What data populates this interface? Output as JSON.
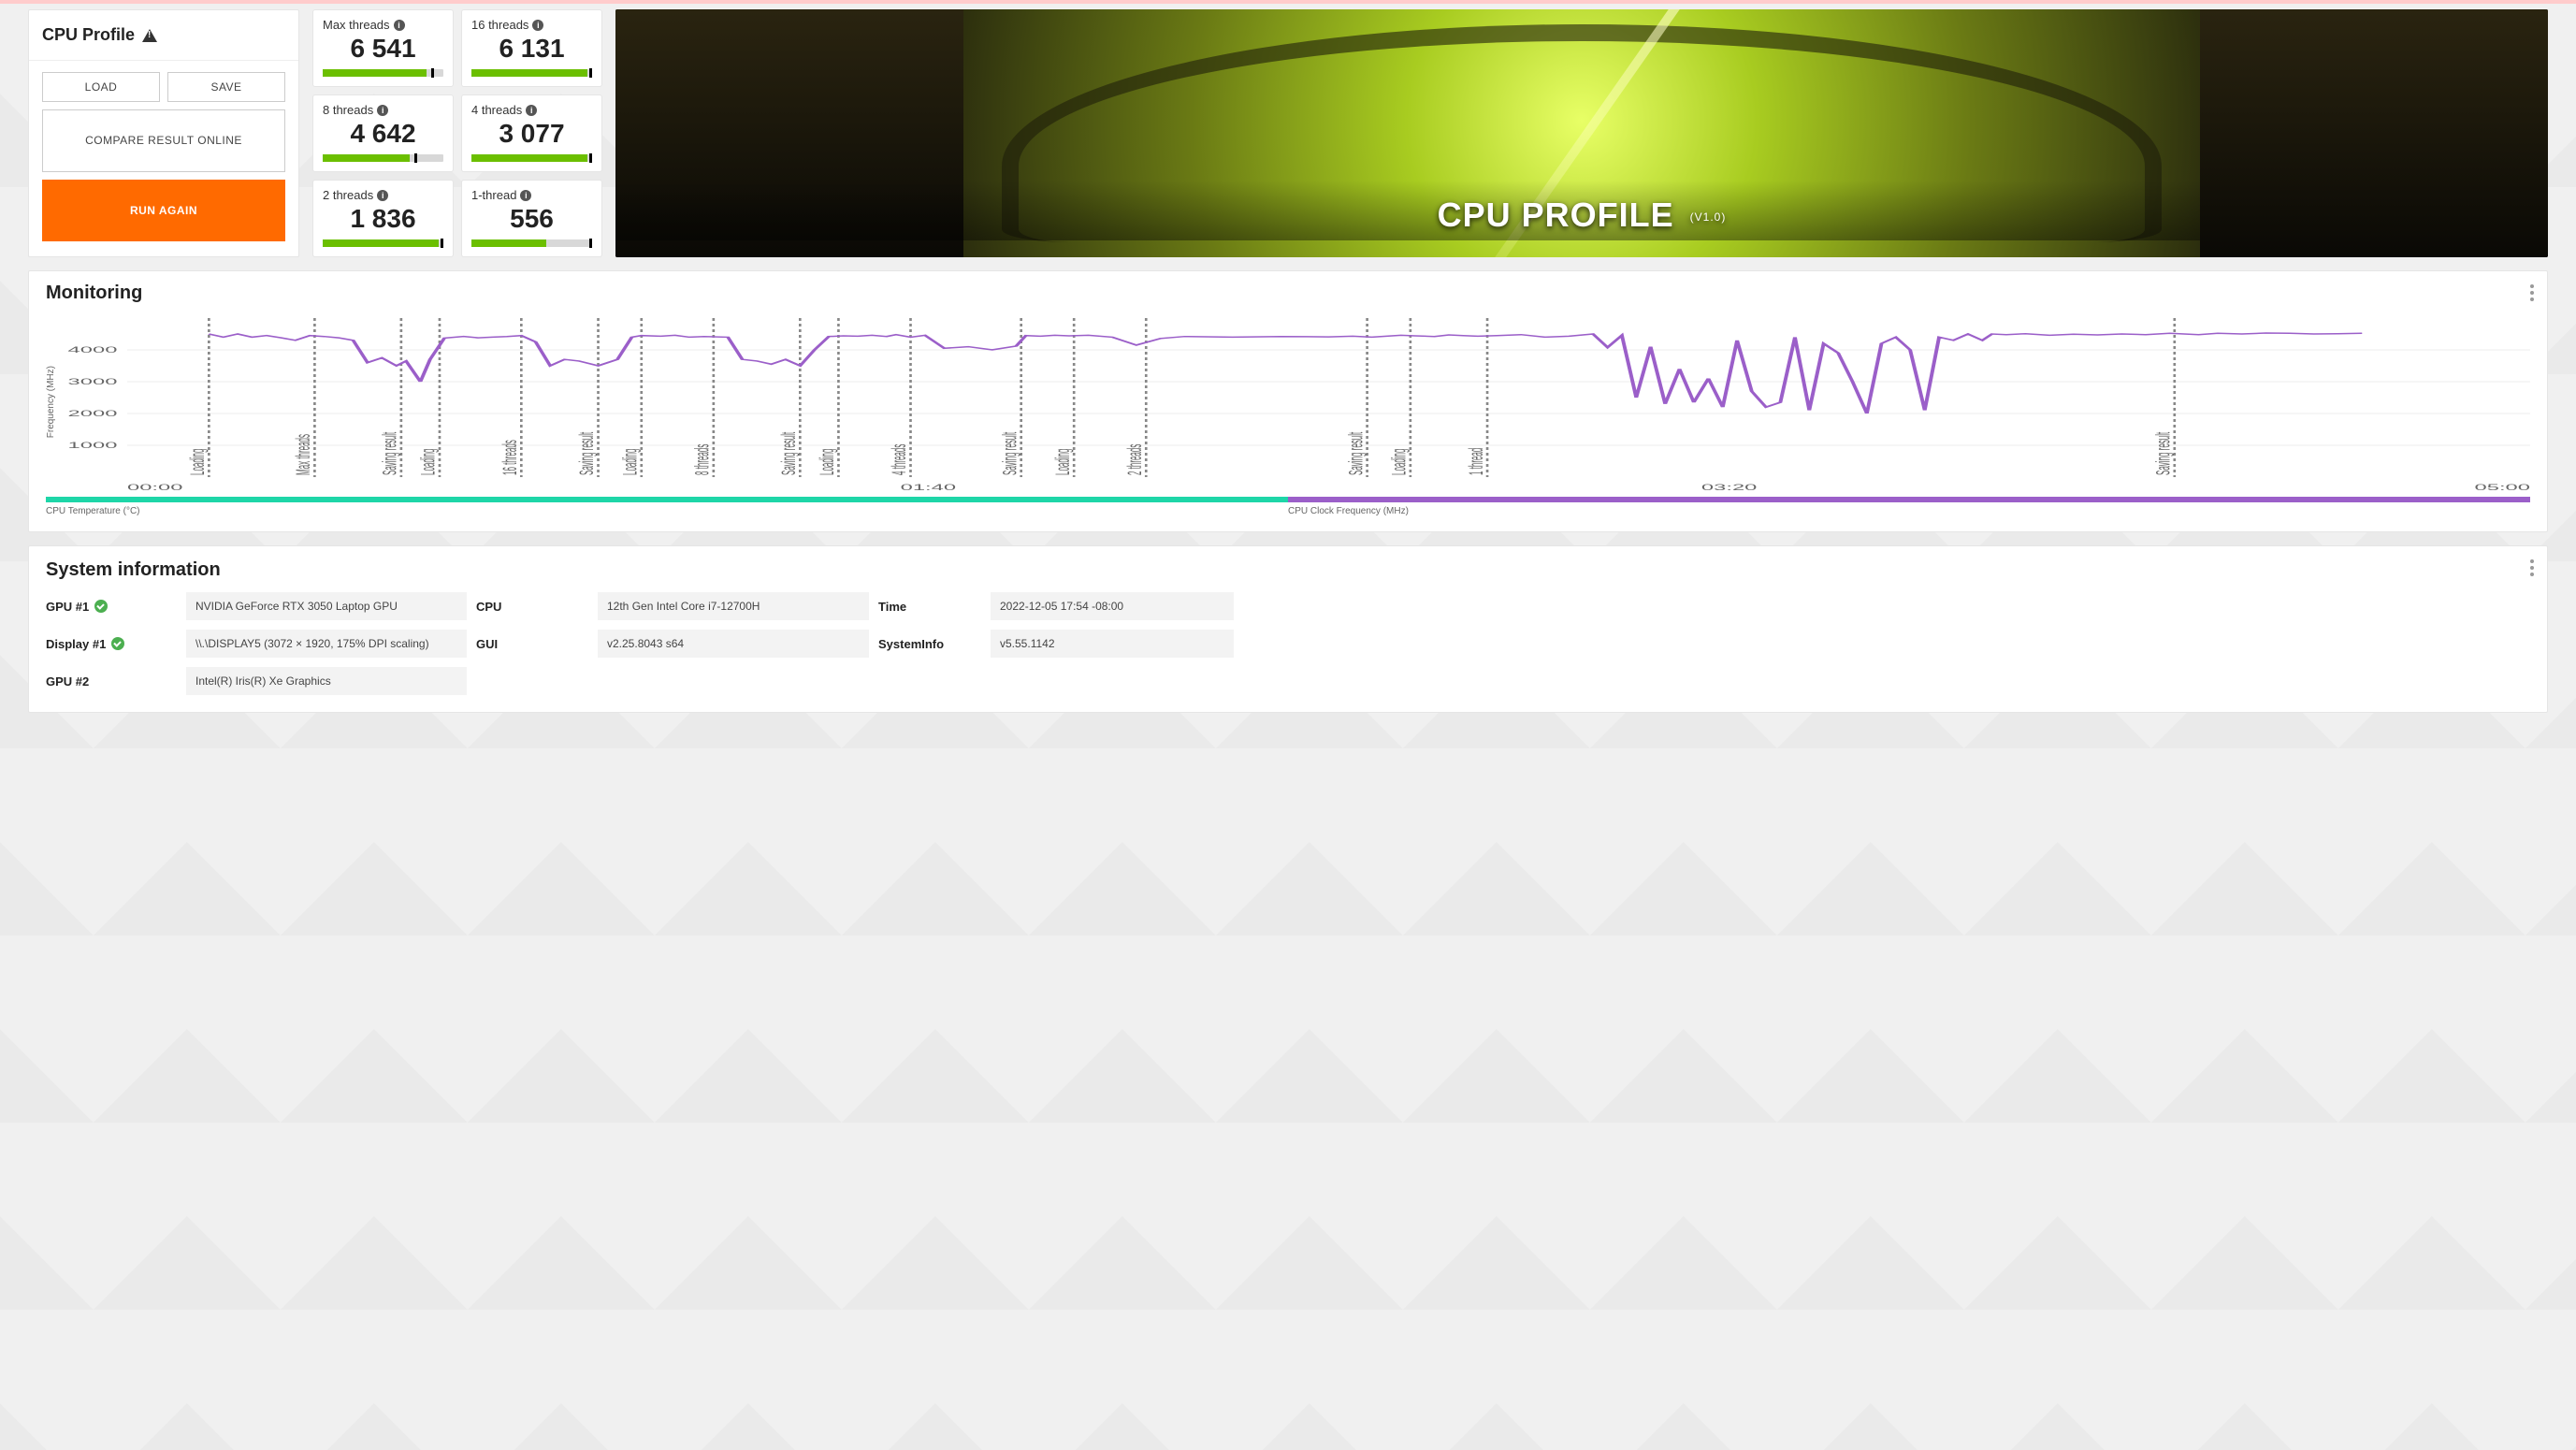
{
  "profile": {
    "title": "CPU Profile",
    "load": "LOAD",
    "save": "SAVE",
    "compare": "COMPARE RESULT ONLINE",
    "run": "RUN AGAIN"
  },
  "scores": [
    {
      "label": "Max threads",
      "value": "6 541",
      "fill": 86,
      "tick": 90
    },
    {
      "label": "16 threads",
      "value": "6 131",
      "fill": 96,
      "tick": 98
    },
    {
      "label": "8 threads",
      "value": "4 642",
      "fill": 72,
      "tick": 76
    },
    {
      "label": "4 threads",
      "value": "3 077",
      "fill": 96,
      "tick": 98
    },
    {
      "label": "2 threads",
      "value": "1 836",
      "fill": 96,
      "tick": 98
    },
    {
      "label": "1-thread",
      "value": "556",
      "fill": 62,
      "tick": 98
    }
  ],
  "hero": {
    "title": "CPU PROFILE",
    "version": "(V1.0)"
  },
  "monitoring": {
    "title": "Monitoring",
    "ylabel": "Frequency (MHz)",
    "legend_left": "CPU Temperature (°C)",
    "legend_right": "CPU Clock Frequency (MHz)"
  },
  "sysinfo": {
    "title": "System information",
    "rows": {
      "gpu1_label": "GPU #1",
      "gpu1": "NVIDIA GeForce RTX 3050 Laptop GPU",
      "cpu_label": "CPU",
      "cpu": "12th Gen Intel Core i7-12700H",
      "time_label": "Time",
      "time": "2022-12-05 17:54 -08:00",
      "disp_label": "Display #1",
      "disp": "\\\\.\\DISPLAY5 (3072 × 1920, 175% DPI scaling)",
      "gui_label": "GUI",
      "gui": "v2.25.8043 s64",
      "si_label": "SystemInfo",
      "si": "v5.55.1142",
      "gpu2_label": "GPU #2",
      "gpu2": "Intel(R) Iris(R) Xe Graphics"
    }
  },
  "chart_data": {
    "type": "line",
    "ylabel": "Frequency (MHz)",
    "ylim": [
      0,
      5000
    ],
    "yticks": [
      1000,
      2000,
      3000,
      4000
    ],
    "xlim": [
      "00:00",
      "05:00"
    ],
    "xticks": [
      "00:00",
      "01:40",
      "03:20",
      "05:00"
    ],
    "phases": [
      {
        "x": 3.4,
        "label": "Loading"
      },
      {
        "x": 7.8,
        "label": "Max threads"
      },
      {
        "x": 11.4,
        "label": "Saving result"
      },
      {
        "x": 13.0,
        "label": "Loading"
      },
      {
        "x": 16.4,
        "label": "16 threads"
      },
      {
        "x": 19.6,
        "label": "Saving result"
      },
      {
        "x": 21.4,
        "label": "Loading"
      },
      {
        "x": 24.4,
        "label": "8 threads"
      },
      {
        "x": 28.0,
        "label": "Saving result"
      },
      {
        "x": 29.6,
        "label": "Loading"
      },
      {
        "x": 32.6,
        "label": "4 threads"
      },
      {
        "x": 37.2,
        "label": "Saving result"
      },
      {
        "x": 39.4,
        "label": "Loading"
      },
      {
        "x": 42.4,
        "label": "2 threads"
      },
      {
        "x": 51.6,
        "label": "Saving result"
      },
      {
        "x": 53.4,
        "label": "Loading"
      },
      {
        "x": 56.6,
        "label": "1 thread"
      },
      {
        "x": 85.2,
        "label": "Saving result"
      }
    ],
    "series": [
      {
        "name": "CPU Clock Frequency (MHz)",
        "color": "#9b5fc9",
        "x_pct": [
          3.4,
          4,
          4.6,
          5.2,
          5.8,
          6.4,
          7,
          7.6,
          8.2,
          8.8,
          9.4,
          10,
          10.6,
          11.2,
          11.6,
          12.2,
          12.6,
          13.2,
          14,
          14.6,
          15.2,
          15.8,
          16.4,
          17,
          17.6,
          18.2,
          18.8,
          19.6,
          20.4,
          21,
          21.4,
          22.2,
          22.8,
          23.4,
          24,
          25,
          25.6,
          26.2,
          26.8,
          27.4,
          28,
          28.6,
          29.2,
          29.8,
          30.4,
          31,
          31.6,
          32,
          32.6,
          33.2,
          34,
          35,
          36,
          37,
          37.4,
          38,
          38.6,
          39.2,
          40,
          41,
          42,
          43,
          44,
          46,
          48,
          50,
          51,
          51.8,
          52.4,
          53,
          53.6,
          54.4,
          55,
          55.6,
          56.2,
          57,
          58,
          59,
          60,
          61,
          61.6,
          62.2,
          62.8,
          63.4,
          64,
          64.6,
          65.2,
          65.8,
          66.4,
          67,
          67.6,
          68.2,
          68.8,
          69.4,
          70,
          70.6,
          71.2,
          71.8,
          72.4,
          73,
          73.6,
          74.2,
          74.8,
          75.4,
          76,
          76.6,
          77.2,
          77.6,
          78.2,
          79,
          80,
          81,
          82,
          83,
          84,
          85,
          85.6,
          86.2,
          87,
          88,
          89,
          90,
          91,
          92,
          93
        ],
        "y_mhz": [
          4500,
          4400,
          4500,
          4400,
          4450,
          4380,
          4300,
          4450,
          4420,
          4380,
          4300,
          3600,
          3750,
          3500,
          3650,
          3000,
          3700,
          4370,
          4420,
          4380,
          4400,
          4420,
          4450,
          4250,
          3500,
          3700,
          3650,
          3500,
          3700,
          4400,
          4450,
          4430,
          4460,
          4400,
          4420,
          4400,
          3700,
          3650,
          3550,
          3700,
          3500,
          4000,
          4420,
          4440,
          4430,
          4460,
          4420,
          4480,
          4400,
          4460,
          4050,
          4100,
          4000,
          4120,
          4450,
          4430,
          4460,
          4440,
          4460,
          4400,
          4150,
          4360,
          4420,
          4400,
          4420,
          4410,
          4430,
          4400,
          4430,
          4460,
          4440,
          4420,
          4470,
          4450,
          4430,
          4450,
          4480,
          4400,
          4430,
          4500,
          4080,
          4460,
          2500,
          4100,
          2300,
          3400,
          2350,
          3100,
          2200,
          4300,
          2700,
          2200,
          2350,
          4400,
          2100,
          4200,
          3900,
          3000,
          2000,
          4200,
          4400,
          4000,
          2100,
          4400,
          4300,
          4500,
          4300,
          4500,
          4480,
          4510,
          4460,
          4490,
          4470,
          4500,
          4480,
          4520,
          4500,
          4480,
          4520,
          4500,
          4530,
          4520,
          4500,
          4510,
          4520
        ]
      }
    ],
    "legend_split_pct": 50,
    "legend_colors": [
      "#1ed6a8",
      "#9b5fc9"
    ]
  }
}
